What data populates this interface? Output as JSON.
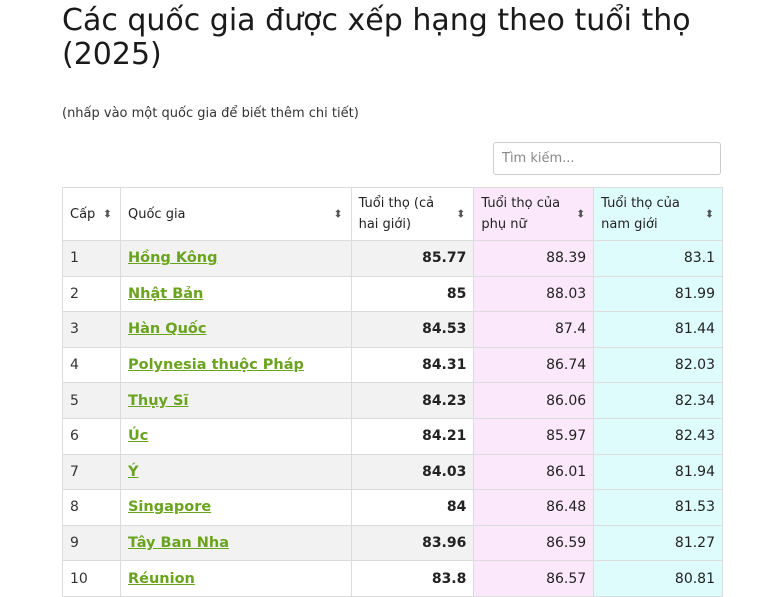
{
  "page": {
    "title": "Các quốc gia được xếp hạng theo tuổi thọ (2025)",
    "subtitle": "(nhấp vào một quốc gia để biết thêm chi tiết)"
  },
  "search": {
    "placeholder": "Tìm kiếm..."
  },
  "table": {
    "headers": [
      "Cấp",
      "Quốc gia",
      "Tuổi thọ (cả hai giới)",
      "Tuổi thọ của phụ nữ",
      "Tuổi thọ của nam giới"
    ],
    "sort_icon": "sort-updown-icon",
    "rows": [
      {
        "rank": "1",
        "country": "Hồng Kông",
        "both": "85.77",
        "female": "88.39",
        "male": "83.1"
      },
      {
        "rank": "2",
        "country": "Nhật Bản",
        "both": "85",
        "female": "88.03",
        "male": "81.99"
      },
      {
        "rank": "3",
        "country": "Hàn Quốc",
        "both": "84.53",
        "female": "87.4",
        "male": "81.44"
      },
      {
        "rank": "4",
        "country": "Polynesia thuộc Pháp",
        "both": "84.31",
        "female": "86.74",
        "male": "82.03"
      },
      {
        "rank": "5",
        "country": "Thụy Sĩ",
        "both": "84.23",
        "female": "86.06",
        "male": "82.34"
      },
      {
        "rank": "6",
        "country": "Úc",
        "both": "84.21",
        "female": "85.97",
        "male": "82.43"
      },
      {
        "rank": "7",
        "country": "Ý",
        "both": "84.03",
        "female": "86.01",
        "male": "81.94"
      },
      {
        "rank": "8",
        "country": "Singapore",
        "both": "84",
        "female": "86.48",
        "male": "81.53"
      },
      {
        "rank": "9",
        "country": "Tây Ban Nha",
        "both": "83.96",
        "female": "86.59",
        "male": "81.27"
      },
      {
        "rank": "10",
        "country": "Réunion",
        "both": "83.8",
        "female": "86.57",
        "male": "80.81"
      }
    ]
  },
  "colors": {
    "link": "#6aa31e",
    "female_col": "#fbe9fb",
    "male_col": "#dffcfc",
    "odd_row": "#f2f2f2"
  }
}
